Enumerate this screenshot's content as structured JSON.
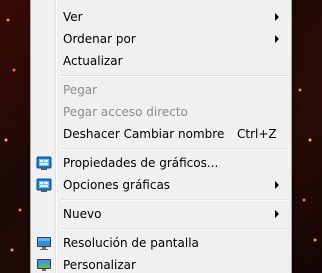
{
  "menu": {
    "items": [
      {
        "label": "Ver"
      },
      {
        "label": "Ordenar por"
      },
      {
        "label": "Actualizar"
      },
      {
        "label": "Pegar"
      },
      {
        "label": "Pegar acceso directo"
      },
      {
        "label": "Deshacer Cambiar nombre",
        "shortcut": "Ctrl+Z"
      },
      {
        "label": "Propiedades de gráficos...",
        "icon": "graphics-properties-icon"
      },
      {
        "label": "Opciones gráficas",
        "icon": "graphics-options-icon"
      },
      {
        "label": "Nuevo"
      },
      {
        "label": "Resolución de pantalla",
        "icon": "monitor-resolution-icon"
      },
      {
        "label": "Personalizar",
        "icon": "personalize-icon"
      }
    ]
  }
}
